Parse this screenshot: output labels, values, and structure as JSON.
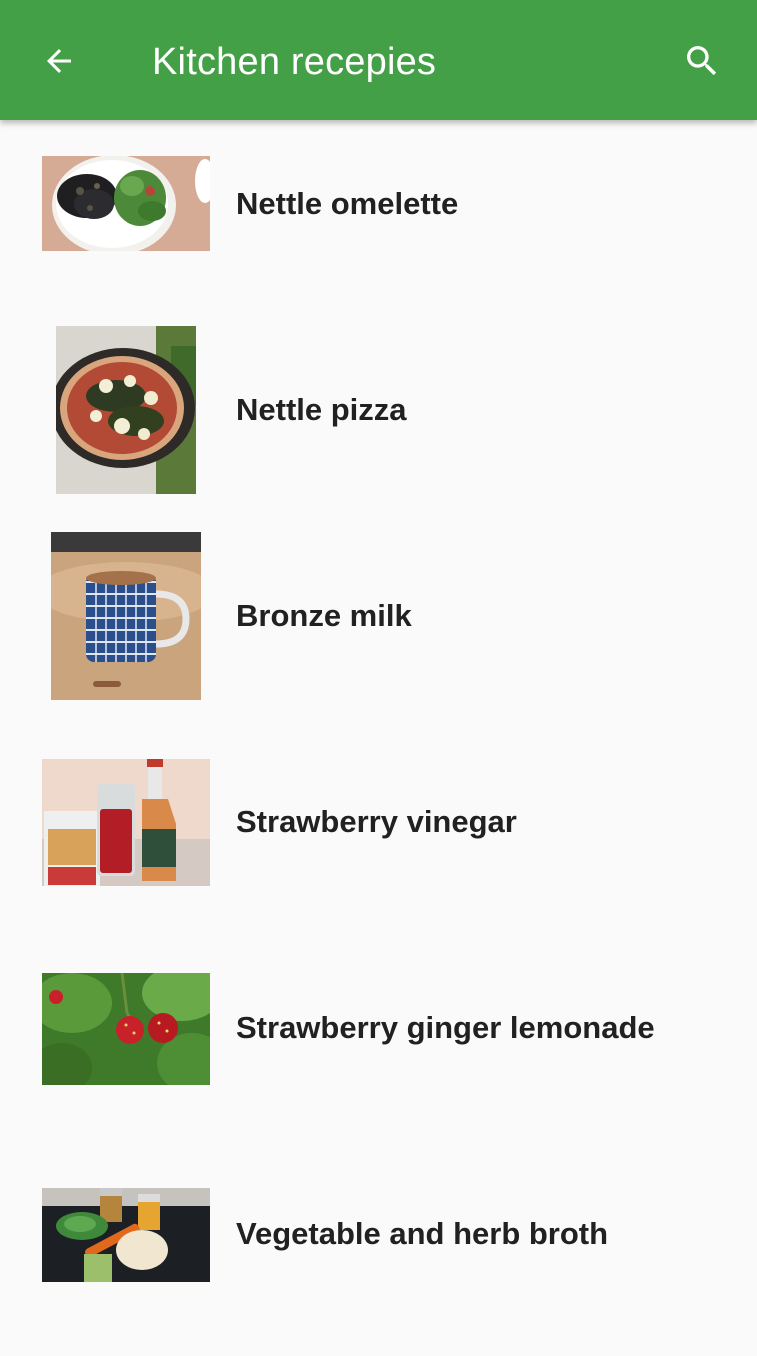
{
  "app_bar": {
    "title": "Kitchen recepies",
    "back_icon": "arrow-left-icon",
    "search_icon": "search-icon",
    "background": "#43a047",
    "foreground": "#ffffff"
  },
  "recipes": [
    {
      "title": "Nettle omelette",
      "thumbnail": "nettle-omelette-photo"
    },
    {
      "title": "Nettle pizza",
      "thumbnail": "nettle-pizza-photo"
    },
    {
      "title": "Bronze milk",
      "thumbnail": "bronze-milk-photo"
    },
    {
      "title": "Strawberry vinegar",
      "thumbnail": "strawberry-vinegar-photo"
    },
    {
      "title": "Strawberry ginger lemonade",
      "thumbnail": "strawberry-plant-photo"
    },
    {
      "title": "Vegetable and herb broth",
      "thumbnail": "vegetable-broth-photo"
    }
  ]
}
